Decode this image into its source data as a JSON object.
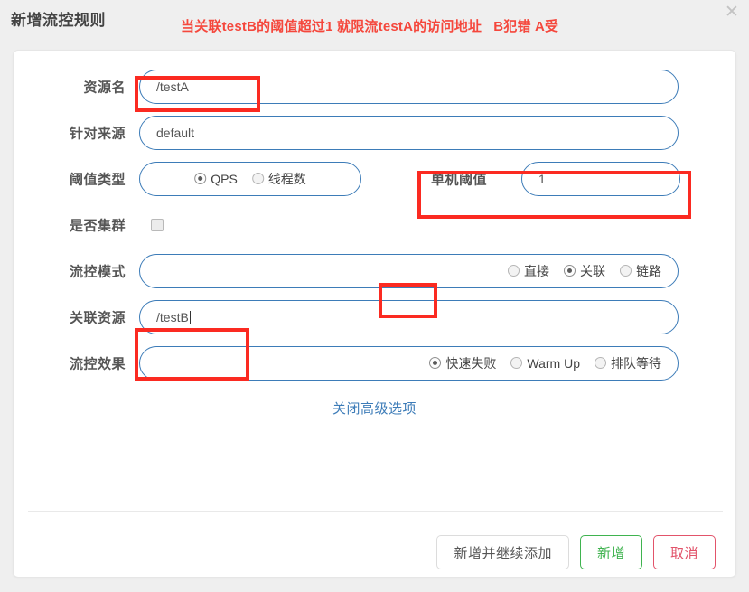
{
  "dialog": {
    "title": "新增流控规则",
    "annotation_note": "当关联testB的阈值超过1 就限流testA的访问地址   B犯错 A受",
    "close_icon": "✕"
  },
  "form": {
    "resource_name": {
      "label": "资源名",
      "value": "/testA"
    },
    "origin": {
      "label": "针对来源",
      "value": "default"
    },
    "threshold_type": {
      "label": "阈值类型",
      "options": [
        "QPS",
        "线程数"
      ],
      "selected": "QPS"
    },
    "single_machine_threshold": {
      "label": "单机阈值",
      "value": "1"
    },
    "is_cluster": {
      "label": "是否集群",
      "checked": false
    },
    "flow_mode": {
      "label": "流控模式",
      "options": [
        "直接",
        "关联",
        "链路"
      ],
      "selected": "关联"
    },
    "related_resource": {
      "label": "关联资源",
      "value": "/testB"
    },
    "flow_effect": {
      "label": "流控效果",
      "options": [
        "快速失败",
        "Warm Up",
        "排队等待"
      ],
      "selected": "快速失败"
    },
    "advanced_link": "关闭高级选项"
  },
  "footer": {
    "add_and_continue_label": "新增并继续添加",
    "add_label": "新增",
    "cancel_label": "取消"
  },
  "colors": {
    "annotation_red": "#fb2a21",
    "field_border_blue": "#3d7cb8",
    "link_blue": "#3d7cb8",
    "primary_green": "#3fb34f",
    "danger_red": "#e2536a",
    "page_background": "#efefef",
    "card_background": "#ffffff"
  }
}
